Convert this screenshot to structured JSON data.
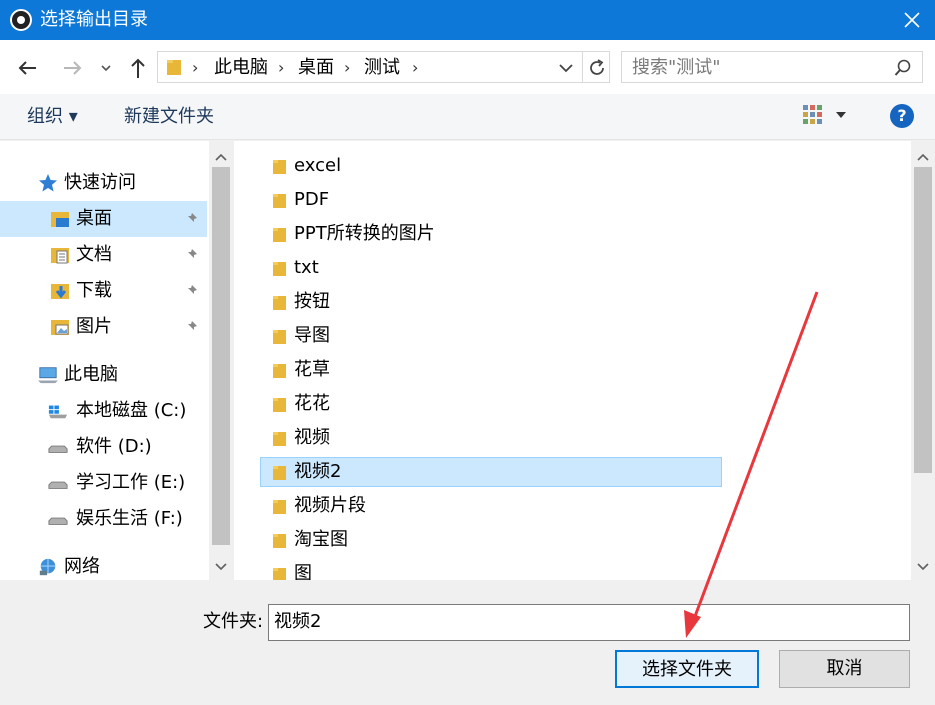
{
  "window": {
    "title": "选择输出目录",
    "close_glyph": "✕"
  },
  "address": {
    "breadcrumbs": [
      "此电脑",
      "桌面",
      "测试"
    ],
    "separator": "›",
    "search_placeholder": "搜索\"测试\""
  },
  "toolbar": {
    "organize_label": "组织 ▾",
    "new_folder_label": "新建文件夹",
    "help_label": "?"
  },
  "nav": {
    "quick_access": "快速访问",
    "quick_items": [
      {
        "label": "桌面",
        "icon": "desktop-folder-icon",
        "pinned": true,
        "selected": true
      },
      {
        "label": "文档",
        "icon": "documents-folder-icon",
        "pinned": true
      },
      {
        "label": "下载",
        "icon": "downloads-folder-icon",
        "pinned": true
      },
      {
        "label": "图片",
        "icon": "pictures-folder-icon",
        "pinned": true
      }
    ],
    "this_pc": "此电脑",
    "drives": [
      {
        "label": "本地磁盘 (C:)",
        "icon": "windows-drive-icon"
      },
      {
        "label": "软件 (D:)",
        "icon": "drive-icon"
      },
      {
        "label": "学习工作 (E:)",
        "icon": "drive-icon"
      },
      {
        "label": "娱乐生活 (F:)",
        "icon": "drive-icon"
      }
    ],
    "network": "网络"
  },
  "files": [
    {
      "name": "excel"
    },
    {
      "name": "PDF"
    },
    {
      "name": "PPT所转换的图片"
    },
    {
      "name": "txt"
    },
    {
      "name": "按钮"
    },
    {
      "name": "导图"
    },
    {
      "name": "花草"
    },
    {
      "name": "花花"
    },
    {
      "name": "视频"
    },
    {
      "name": "视频2",
      "selected": true
    },
    {
      "name": "视频片段"
    },
    {
      "name": "淘宝图"
    },
    {
      "name": "图"
    }
  ],
  "footer": {
    "folder_label": "文件夹:",
    "folder_value": "视频2",
    "select_button": "选择文件夹",
    "cancel_button": "取消"
  },
  "colors": {
    "titlebar": "#0d78d7",
    "selection": "#cce8ff",
    "annotation_arrow": "#e8383d"
  }
}
